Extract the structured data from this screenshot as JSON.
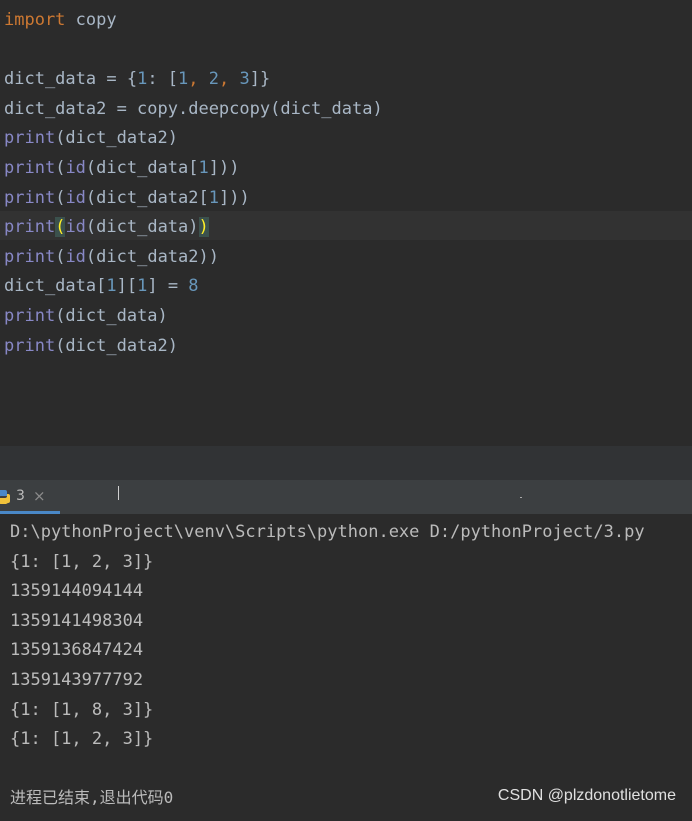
{
  "editor": {
    "lines": [
      {
        "parts": [
          {
            "t": "import",
            "c": "kw"
          },
          {
            "t": " copy",
            "c": ""
          }
        ]
      },
      {
        "parts": []
      },
      {
        "parts": [
          {
            "t": "dict_data = {",
            "c": ""
          },
          {
            "t": "1",
            "c": "num"
          },
          {
            "t": ": [",
            "c": ""
          },
          {
            "t": "1",
            "c": "num"
          },
          {
            "t": ", ",
            "c": "kw"
          },
          {
            "t": "2",
            "c": "num"
          },
          {
            "t": ", ",
            "c": "kw"
          },
          {
            "t": "3",
            "c": "num"
          },
          {
            "t": "]}",
            "c": ""
          }
        ]
      },
      {
        "parts": [
          {
            "t": "dict_data2 = copy.deepcopy(dict_data)",
            "c": ""
          }
        ]
      },
      {
        "parts": [
          {
            "t": "print",
            "c": "fn"
          },
          {
            "t": "(dict_data2)",
            "c": ""
          }
        ]
      },
      {
        "parts": [
          {
            "t": "print",
            "c": "fn"
          },
          {
            "t": "(",
            "c": ""
          },
          {
            "t": "id",
            "c": "fn"
          },
          {
            "t": "(dict_data[",
            "c": ""
          },
          {
            "t": "1",
            "c": "num"
          },
          {
            "t": "]))",
            "c": ""
          }
        ]
      },
      {
        "parts": [
          {
            "t": "print",
            "c": "fn"
          },
          {
            "t": "(",
            "c": ""
          },
          {
            "t": "id",
            "c": "fn"
          },
          {
            "t": "(dict_data2[",
            "c": ""
          },
          {
            "t": "1",
            "c": "num"
          },
          {
            "t": "]))",
            "c": ""
          }
        ]
      },
      {
        "parts": [
          {
            "t": "print",
            "c": "fn"
          },
          {
            "t": "(",
            "c": "brace-match"
          },
          {
            "t": "id",
            "c": "fn"
          },
          {
            "t": "(dict_data)",
            "c": ""
          },
          {
            "t": ")",
            "c": "brace-match"
          }
        ]
      },
      {
        "parts": [
          {
            "t": "print",
            "c": "fn"
          },
          {
            "t": "(",
            "c": ""
          },
          {
            "t": "id",
            "c": "fn"
          },
          {
            "t": "(dict_data2))",
            "c": ""
          }
        ]
      },
      {
        "parts": [
          {
            "t": "dict_data[",
            "c": ""
          },
          {
            "t": "1",
            "c": "num"
          },
          {
            "t": "][",
            "c": ""
          },
          {
            "t": "1",
            "c": "num"
          },
          {
            "t": "] = ",
            "c": ""
          },
          {
            "t": "8",
            "c": "num"
          }
        ]
      },
      {
        "parts": [
          {
            "t": "print",
            "c": "fn"
          },
          {
            "t": "(dict_data)",
            "c": ""
          }
        ]
      },
      {
        "parts": [
          {
            "t": "print",
            "c": "fn"
          },
          {
            "t": "(dict_data2)",
            "c": ""
          }
        ]
      }
    ]
  },
  "run_tab": {
    "label": "3",
    "close": "×",
    "icon": "python-icon"
  },
  "console": {
    "lines": [
      "D:\\pythonProject\\venv\\Scripts\\python.exe D:/pythonProject/3.py",
      "{1: [1, 2, 3]}",
      "1359144094144",
      "1359141498304",
      "1359136847424",
      "1359143977792",
      "{1: [1, 8, 3]}",
      "{1: [1, 2, 3]}"
    ],
    "finish_message": "进程已结束,退出代码0"
  },
  "watermark": "CSDN @plzdonotlietome",
  "colors": {
    "background": "#2b2b2b",
    "keyword": "#cc7832",
    "builtin": "#8888c6",
    "number": "#6897bb",
    "text": "#a9b7c6"
  }
}
